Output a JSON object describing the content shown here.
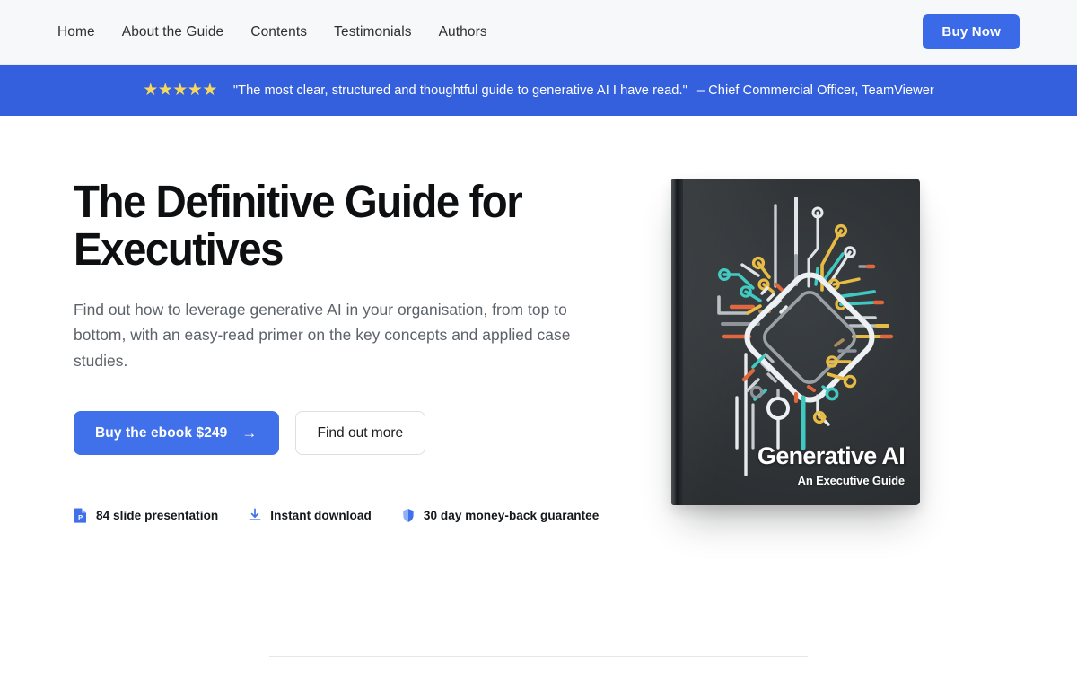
{
  "header": {
    "nav": [
      {
        "label": "Home",
        "name": "nav-home"
      },
      {
        "label": "About the Guide",
        "name": "nav-about-the-guide"
      },
      {
        "label": "Contents",
        "name": "nav-contents"
      },
      {
        "label": "Testimonials",
        "name": "nav-testimonials"
      },
      {
        "label": "Authors",
        "name": "nav-authors"
      }
    ],
    "cta_label": "Buy Now",
    "background_color": "#f7f8f9",
    "cta_color": "#3a6ae8"
  },
  "banner": {
    "stars": "★★★★★",
    "star_count": 5,
    "star_color": "#f7d85c",
    "quote": "\"The most clear, structured and thoughtful guide to generative AI I have read.\"",
    "attribution": "– Chief Commercial Officer, TeamViewer",
    "background_color": "#3460de"
  },
  "hero": {
    "headline": "The Definitive Guide for Executives",
    "subheadline": "Find out how to leverage generative AI in your organisation, from top to bottom, with an easy-read primer on the key concepts and applied case studies.",
    "primary_cta": {
      "label": "Buy the ebook $249",
      "arrow": "→",
      "price": "$249",
      "color": "#4070ea"
    },
    "secondary_cta": {
      "label": "Find out more"
    },
    "features": [
      {
        "icon": "presentation-file-icon",
        "label": "84 slide presentation"
      },
      {
        "icon": "download-icon",
        "label": "Instant download"
      },
      {
        "icon": "shield-icon",
        "label": "30 day money-back guarantee"
      }
    ]
  },
  "book": {
    "title": "Generative AI",
    "subtitle": "An Executive Guide",
    "cover_color": "#303437",
    "artwork": "circuit-board-chip-illustration"
  }
}
